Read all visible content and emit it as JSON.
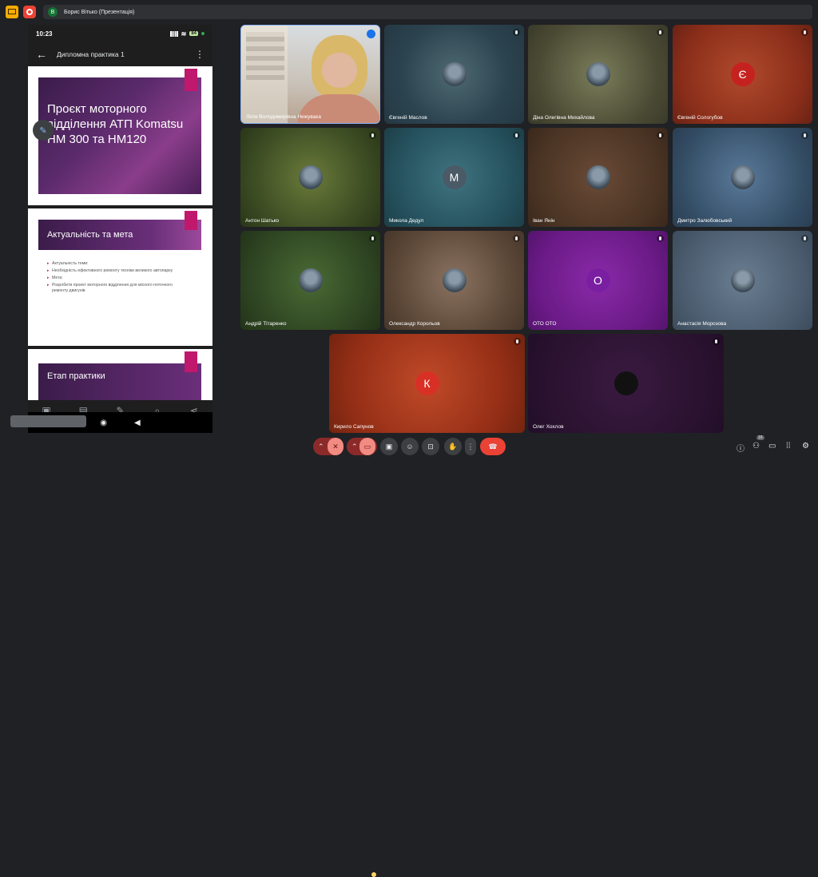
{
  "topbar": {
    "avatar_letter": "B",
    "title": "Борис Вітько (Презентація)"
  },
  "phone": {
    "time": "10:23",
    "battery": "84",
    "doc_title": "Дипломна практика 1",
    "slide1": {
      "title": "Проєкт моторного відділення АТП Komatsu HM 300 та HM120"
    },
    "slide2": {
      "title": "Актуальність та мета",
      "bullets": [
        "Актуальність теми:",
        "Необхідність ефективного ремонту техніки великого автопарку",
        "Мета:",
        "Розробити проект моторного відділення для місного поточного ремонту двигунів"
      ]
    },
    "slide3": {
      "title": "Етап практики"
    },
    "tools": [
      {
        "icon": "present-icon",
        "label": "Розпочати презентацію"
      },
      {
        "icon": "notes-icon",
        "label": "Нотатки"
      },
      {
        "icon": "edit-icon",
        "label": "Редагування"
      },
      {
        "icon": "search-icon",
        "label": "Знайти"
      },
      {
        "icon": "share-icon",
        "label": "Спільний доступ"
      }
    ]
  },
  "participants": [
    {
      "name": "Лілія Володимирівна Нежувака",
      "avatar": ""
    },
    {
      "name": "Євгеній Маслов",
      "avatar": ""
    },
    {
      "name": "Діна Олегівна Михайлова",
      "avatar": ""
    },
    {
      "name": "Євгеній Сологубов",
      "avatar": "Є"
    },
    {
      "name": "Антон Шатько",
      "avatar": ""
    },
    {
      "name": "Микола Дедул",
      "avatar": "М"
    },
    {
      "name": "Іван Янін",
      "avatar": ""
    },
    {
      "name": "Дмитро Залюбовський",
      "avatar": ""
    },
    {
      "name": "Андрій Тітаренко",
      "avatar": ""
    },
    {
      "name": "Олександр Корольов",
      "avatar": ""
    },
    {
      "name": "ОТО ОТО",
      "avatar": "О"
    },
    {
      "name": "Анастасія Морозова",
      "avatar": ""
    },
    {
      "name": "Кирило Сапунов",
      "avatar": "К"
    },
    {
      "name": "Олег Хохлов",
      "avatar": ""
    }
  ],
  "controls": {
    "people_count": "16"
  },
  "colors": {
    "hangup": "#ea4335",
    "accent": "#8ab4f8",
    "slide_accent": "#c0186c"
  }
}
